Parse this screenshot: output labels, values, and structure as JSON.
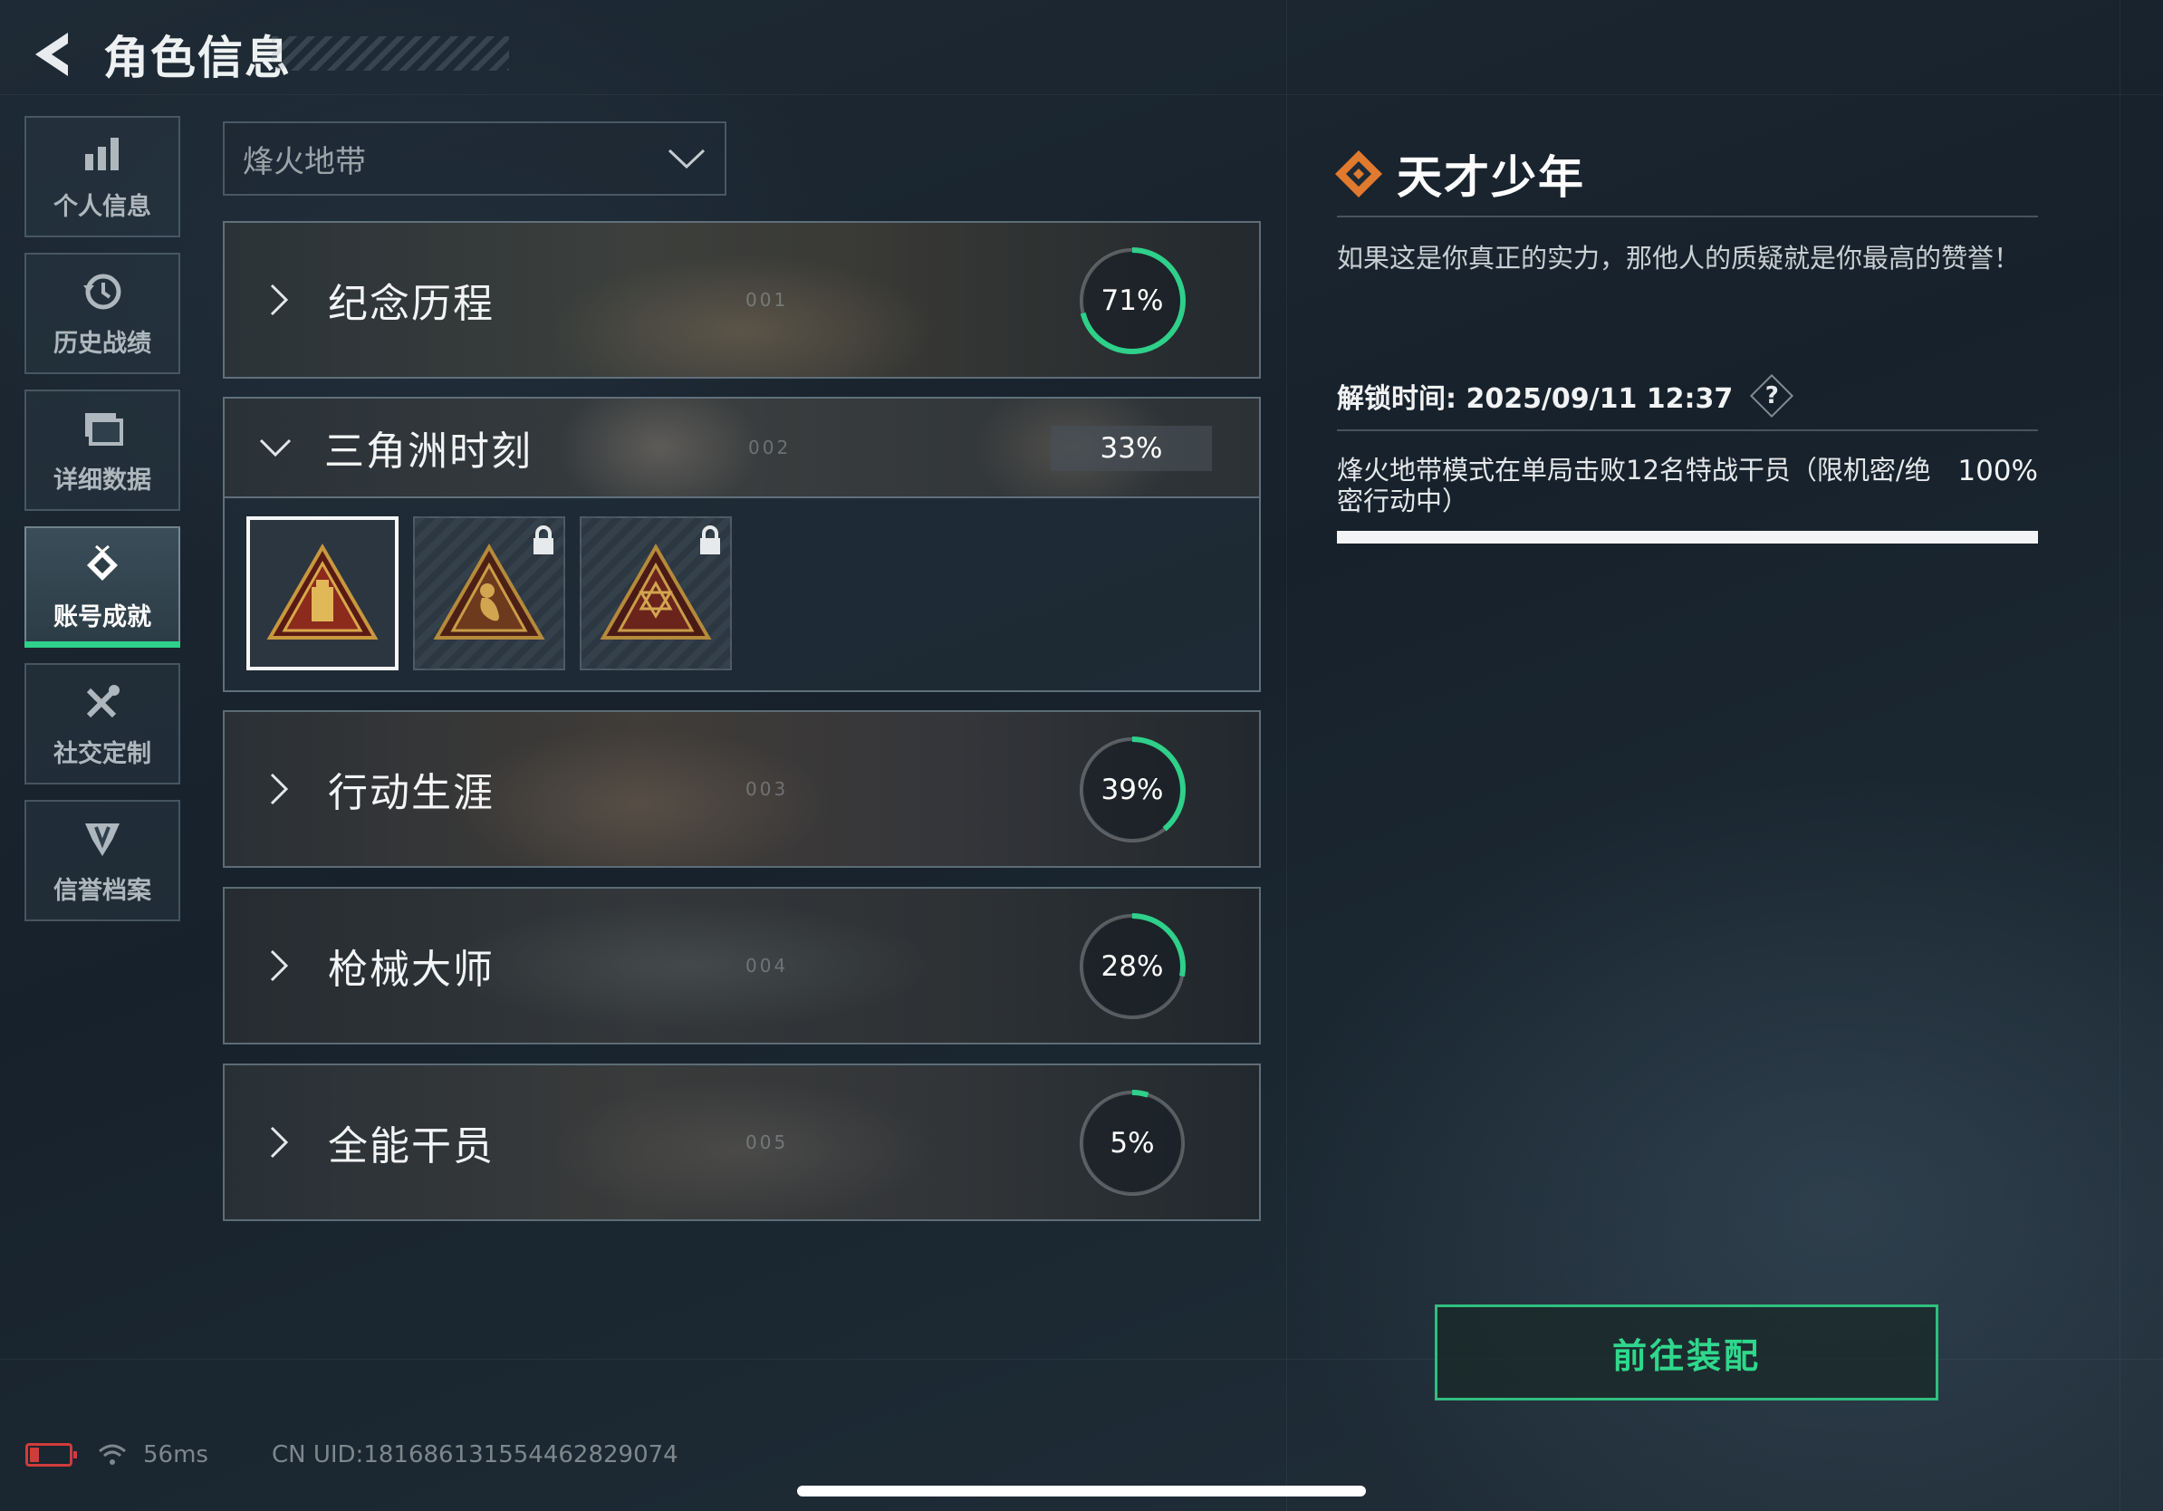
{
  "header": {
    "title": "角色信息"
  },
  "sidebar": {
    "items": [
      {
        "label": "个人信息",
        "icon": "bar-chart-icon"
      },
      {
        "label": "历史战绩",
        "icon": "history-clock-icon"
      },
      {
        "label": "详细数据",
        "icon": "folder-data-icon"
      },
      {
        "label": "账号成就",
        "icon": "achievement-medal-icon",
        "active": true
      },
      {
        "label": "社交定制",
        "icon": "wrench-tools-icon"
      },
      {
        "label": "信誉档案",
        "icon": "credit-shield-icon"
      }
    ]
  },
  "mode_select": {
    "value": "烽火地带"
  },
  "categories": [
    {
      "name": "纪念历程",
      "number": "001",
      "progress_label": "71%",
      "progress": 0.71,
      "expanded": false
    },
    {
      "name": "三角洲时刻",
      "number": "002",
      "progress_label": "33%",
      "progress": 0.33,
      "expanded": true
    },
    {
      "name": "行动生涯",
      "number": "003",
      "progress_label": "39%",
      "progress": 0.39,
      "expanded": false
    },
    {
      "name": "枪械大师",
      "number": "004",
      "progress_label": "28%",
      "progress": 0.28,
      "expanded": false
    },
    {
      "name": "全能干员",
      "number": "005",
      "progress_label": "5%",
      "progress": 0.05,
      "expanded": false
    }
  ],
  "badges": [
    {
      "icon": "usb-triangle-badge-icon",
      "locked": false,
      "selected": true
    },
    {
      "icon": "mermaid-triangle-badge-icon",
      "locked": true,
      "selected": false
    },
    {
      "icon": "hexagram-hands-badge-icon",
      "locked": true,
      "selected": false
    }
  ],
  "detail": {
    "title": "天才少年",
    "description": "如果这是你真正的实力，那他人的质疑就是你最高的赞誉！",
    "unlock_time": "解锁时间: 2025/09/11 12:37",
    "help_label": "?",
    "requirement": "烽火地带模式在单局击败12名特战干员（限机密/绝密行动中）",
    "requirement_progress_label": "100%",
    "requirement_progress": 1.0
  },
  "equip_button": {
    "label": "前往装配"
  },
  "status_bar": {
    "ping": "56ms",
    "uid": "CN UID:18168613155446282907​4"
  },
  "colors": {
    "accent": "#2ed08a",
    "badge_orange": "#e07a2e",
    "battery_low": "#d23b3b"
  }
}
